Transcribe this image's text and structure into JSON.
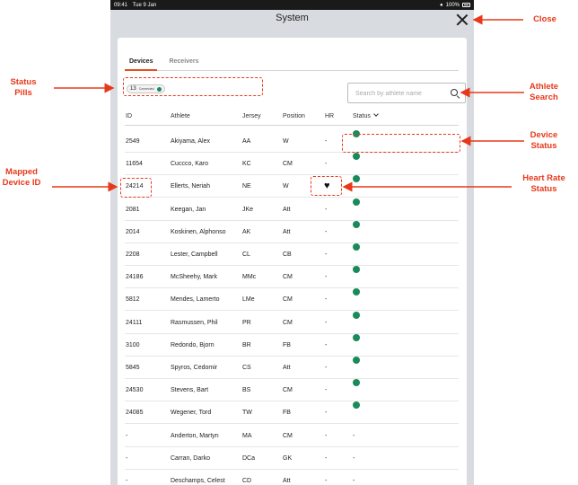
{
  "status_bar": {
    "time": "09:41",
    "date": "Tue 9 Jan",
    "battery": "100%"
  },
  "sheet": {
    "title": "System"
  },
  "tabs": [
    {
      "label": "Devices",
      "active": true
    },
    {
      "label": "Receivers",
      "active": false
    }
  ],
  "status_pills": {
    "count": "13",
    "label": "Connected"
  },
  "search": {
    "placeholder": "Search by athlete name",
    "value": ""
  },
  "table": {
    "columns": [
      "ID",
      "Athlete",
      "Jersey",
      "Position",
      "HR",
      "Status"
    ],
    "rows": [
      {
        "id": "2549",
        "athlete": "Akiyama, Alex",
        "jersey": "AA",
        "position": "W",
        "hr": "-",
        "status": "connected"
      },
      {
        "id": "11654",
        "athlete": "Cuccco, Karo",
        "jersey": "KC",
        "position": "CM",
        "hr": "-",
        "status": "connected"
      },
      {
        "id": "24214",
        "athlete": "Ellerts, Neriah",
        "jersey": "NE",
        "position": "W",
        "hr": "heart",
        "status": "connected"
      },
      {
        "id": "2081",
        "athlete": "Keegan, Jan",
        "jersey": "JKe",
        "position": "Att",
        "hr": "-",
        "status": "connected"
      },
      {
        "id": "2014",
        "athlete": "Koskinen, Alphonso",
        "jersey": "AK",
        "position": "Att",
        "hr": "-",
        "status": "connected"
      },
      {
        "id": "2208",
        "athlete": "Lester, Campbell",
        "jersey": "CL",
        "position": "CB",
        "hr": "-",
        "status": "connected"
      },
      {
        "id": "24186",
        "athlete": "McSheehy, Mark",
        "jersey": "MMc",
        "position": "CM",
        "hr": "-",
        "status": "connected"
      },
      {
        "id": "5812",
        "athlete": "Mendes, Lamerto",
        "jersey": "LMe",
        "position": "CM",
        "hr": "-",
        "status": "connected"
      },
      {
        "id": "24111",
        "athlete": "Rasmussen, Phil",
        "jersey": "PR",
        "position": "CM",
        "hr": "-",
        "status": "connected"
      },
      {
        "id": "3100",
        "athlete": "Redondo, Bjorn",
        "jersey": "BR",
        "position": "FB",
        "hr": "-",
        "status": "connected"
      },
      {
        "id": "5845",
        "athlete": "Spyros, Cedomir",
        "jersey": "CS",
        "position": "Att",
        "hr": "-",
        "status": "connected"
      },
      {
        "id": "24530",
        "athlete": "Stevens, Bart",
        "jersey": "BS",
        "position": "CM",
        "hr": "-",
        "status": "connected"
      },
      {
        "id": "24085",
        "athlete": "Wegener, Tord",
        "jersey": "TW",
        "position": "FB",
        "hr": "-",
        "status": "connected"
      },
      {
        "id": "-",
        "athlete": "Anderton, Martyn",
        "jersey": "MA",
        "position": "CM",
        "hr": "-",
        "status": "-"
      },
      {
        "id": "-",
        "athlete": "Carran, Darko",
        "jersey": "DCa",
        "position": "GK",
        "hr": "-",
        "status": "-"
      },
      {
        "id": "-",
        "athlete": "Deschamps, Celest",
        "jersey": "CD",
        "position": "Att",
        "hr": "-",
        "status": "-"
      }
    ]
  },
  "annotations": {
    "close": "Close",
    "status_pills": "Status Pills",
    "athlete_search": "Athlete Search",
    "device_status": "Device Status",
    "mapped_device_id": "Mapped Device ID",
    "heart_rate_status": "Heart Rate Status"
  },
  "colors": {
    "annotation": "#e8381a",
    "connected": "#1a8a5c",
    "tab_accent": "#e6501e",
    "frame": "#d8dbe0"
  },
  "icons": {
    "close": "close-icon",
    "search": "search-icon",
    "heart": "heart-rate-icon",
    "sort": "chevron-down-icon"
  }
}
